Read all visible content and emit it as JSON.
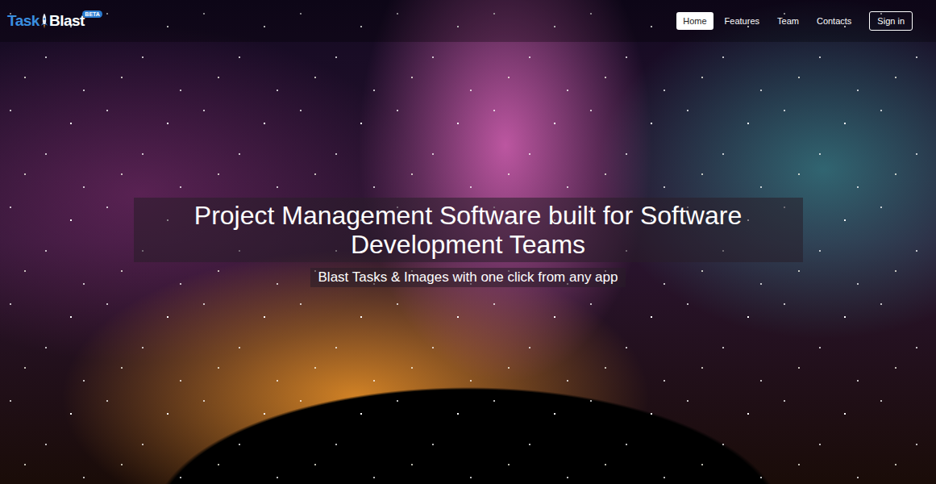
{
  "logo": {
    "first": "Task",
    "second": "Blast",
    "badge": "BETA"
  },
  "nav": [
    {
      "label": "Home",
      "selected": true,
      "kind": "link"
    },
    {
      "label": "Features",
      "selected": false,
      "kind": "link"
    },
    {
      "label": "Team",
      "selected": false,
      "kind": "link"
    },
    {
      "label": "Contacts",
      "selected": false,
      "kind": "link"
    },
    {
      "label": "Sign in",
      "selected": false,
      "kind": "button"
    }
  ],
  "hero": {
    "title": "Project Management Software built for Software Development Teams",
    "subtitle": "Blast Tasks & Images with one click from any app"
  }
}
